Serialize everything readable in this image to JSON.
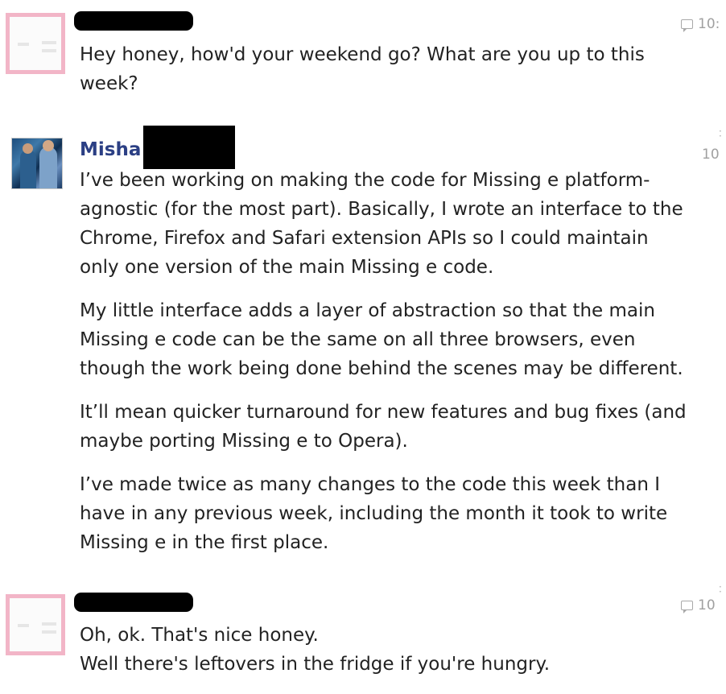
{
  "messages": [
    {
      "sender": "",
      "time": "10:",
      "lines": [
        "Hey honey, how'd your weekend go? What are you up to this",
        "week?"
      ]
    },
    {
      "sender": "Misha",
      "time": "10",
      "paragraphs": [
        "I’ve been working on making the code for Missing e platform-agnostic (for the most part). Basically, I wrote an interface to the Chrome, Firefox and Safari extension APIs so I could maintain only one version of the main Missing e code.",
        "My little interface adds a layer of abstraction so that the main Missing e code can be the same on all three browsers, even though the work being done behind the scenes may be different.",
        "It’ll mean quicker turnaround for new features and bug fixes (and maybe porting Missing e to Opera).",
        "I’ve made twice as many changes to the code this week than I have in any previous week, including the month it took to write Missing e in the first place."
      ]
    },
    {
      "sender": "",
      "time": "10",
      "lines": [
        "Oh, ok. That's nice honey.",
        "Well there's leftovers in the fridge if you're hungry."
      ]
    }
  ],
  "icons": {
    "comment": "speech-bubble-icon",
    "avatar_placeholder": "avatar-placeholder-icon"
  },
  "colors": {
    "name_link": "#2b3f84",
    "avatar_border": "#f2b5c7",
    "redaction": "#000000",
    "timestamp": "#a0a0a0"
  }
}
